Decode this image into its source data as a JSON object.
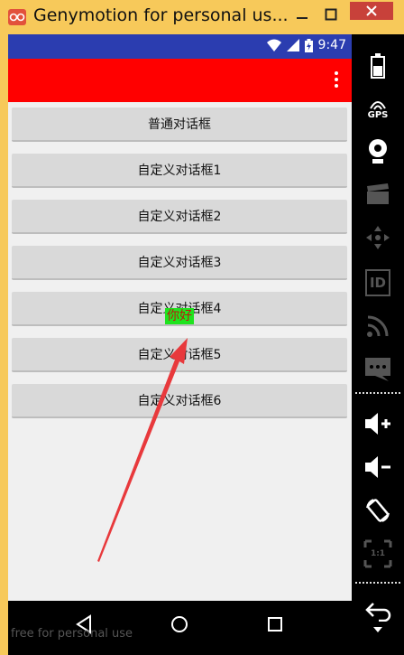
{
  "window": {
    "title": "Genymotion for personal us...",
    "minimize_label": "—",
    "close_label": "✕"
  },
  "statusbar": {
    "time": "9:47"
  },
  "buttons": [
    {
      "label": "普通对话框"
    },
    {
      "label": "自定义对话框1"
    },
    {
      "label": "自定义对话框2"
    },
    {
      "label": "自定义对话框3"
    },
    {
      "label": "自定义对话框4"
    },
    {
      "label": "自定义对话框5"
    },
    {
      "label": "自定义对话框6"
    }
  ],
  "toast": {
    "text": "你好"
  },
  "watermark": "free for personal use",
  "toolbar": {
    "gps_label": "GPS",
    "id_label": "ID",
    "pixel_label": "1:1"
  },
  "colors": {
    "titlebar": "#f7c95a",
    "statusbar": "#2b3db0",
    "actionbar": "#ff0000",
    "toast_bg": "#1ee31e",
    "toast_text": "#c0130f",
    "annotation_arrow": "#e8393c"
  }
}
